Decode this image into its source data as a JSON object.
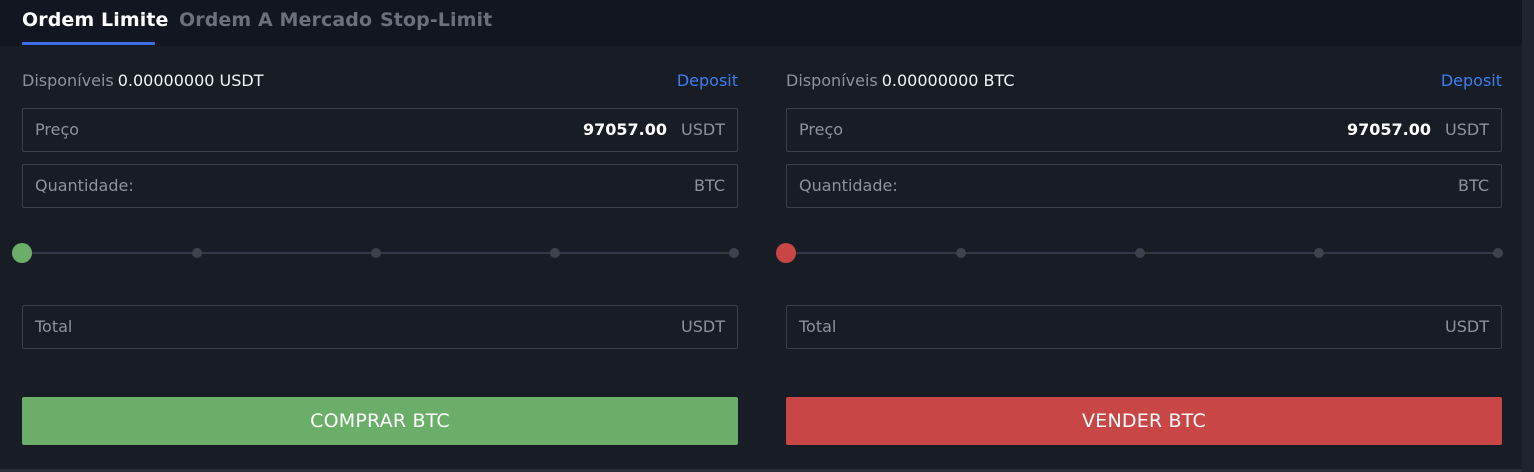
{
  "tabs": [
    {
      "label": "Ordem Limite",
      "active": true
    },
    {
      "label": "Ordem A Mercado",
      "active": false
    },
    {
      "label": "Stop-Limit",
      "active": false
    }
  ],
  "buy": {
    "available_label": "Disponíveis",
    "available_value": "0.00000000 USDT",
    "deposit_label": "Deposit",
    "price": {
      "label": "Preço",
      "value": "97057.00",
      "unit": "USDT"
    },
    "quantity": {
      "label": "Quantidade:",
      "value": "",
      "unit": "BTC"
    },
    "slider_value_percent": 0,
    "total": {
      "label": "Total",
      "value": "",
      "unit": "USDT"
    },
    "button_label": "COMPRAR BTC"
  },
  "sell": {
    "available_label": "Disponíveis",
    "available_value": "0.00000000 BTC",
    "deposit_label": "Deposit",
    "price": {
      "label": "Preço",
      "value": "97057.00",
      "unit": "USDT"
    },
    "quantity": {
      "label": "Quantidade:",
      "value": "",
      "unit": "BTC"
    },
    "slider_value_percent": 0,
    "total": {
      "label": "Total",
      "value": "",
      "unit": "USDT"
    },
    "button_label": "VENDER BTC"
  },
  "colors": {
    "background": "#171c25",
    "tab_bar": "#111620",
    "accent_blue": "#3d6fe6",
    "buy_green": "#6aae6a",
    "sell_red": "#c94646"
  }
}
